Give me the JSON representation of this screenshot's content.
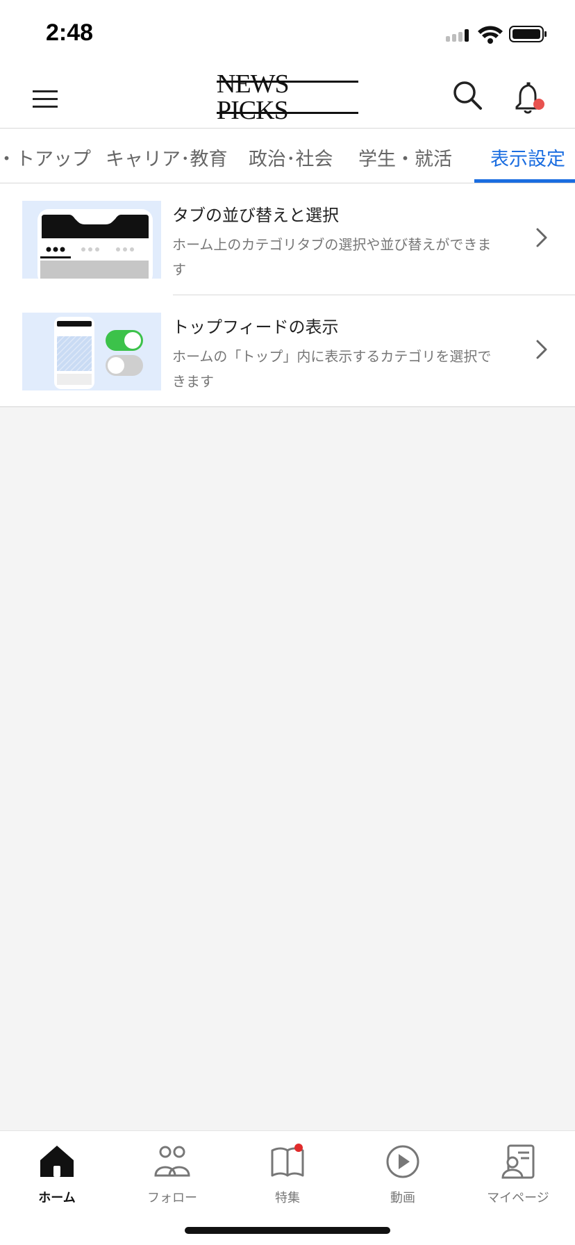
{
  "status_bar": {
    "time": "2:48"
  },
  "header": {
    "logo": "NEWS PICKS",
    "menu_icon": "hamburger-menu-icon",
    "search_icon": "search-icon",
    "bell_icon": "bell-icon",
    "notification_dot_color": "#e8524f"
  },
  "tabs": [
    {
      "label": "・トアップ",
      "active": false
    },
    {
      "label": "キャリア･教育",
      "active": false
    },
    {
      "label": "政治･社会",
      "active": false
    },
    {
      "label": "学生・就活",
      "active": false
    },
    {
      "label": "表示設定",
      "active": true
    }
  ],
  "accent_color": "#1a6de0",
  "settings": [
    {
      "title": "タブの並び替えと選択",
      "description": "ホーム上のカテゴリタブの選択や並び替えができます",
      "icon": "tab-reorder-illustration",
      "chevron": "chevron-right-icon"
    },
    {
      "title": "トップフィードの表示",
      "description": "ホームの「トップ」内に表示するカテゴリを選択できます",
      "icon": "top-feed-toggle-illustration",
      "chevron": "chevron-right-icon"
    }
  ],
  "bottom_nav": [
    {
      "label": "ホーム",
      "icon": "home-icon",
      "active": true
    },
    {
      "label": "フォロー",
      "icon": "people-icon",
      "active": false
    },
    {
      "label": "特集",
      "icon": "book-icon",
      "active": false
    },
    {
      "label": "動画",
      "icon": "play-icon",
      "active": false
    },
    {
      "label": "マイページ",
      "icon": "profile-card-icon",
      "active": false
    }
  ]
}
